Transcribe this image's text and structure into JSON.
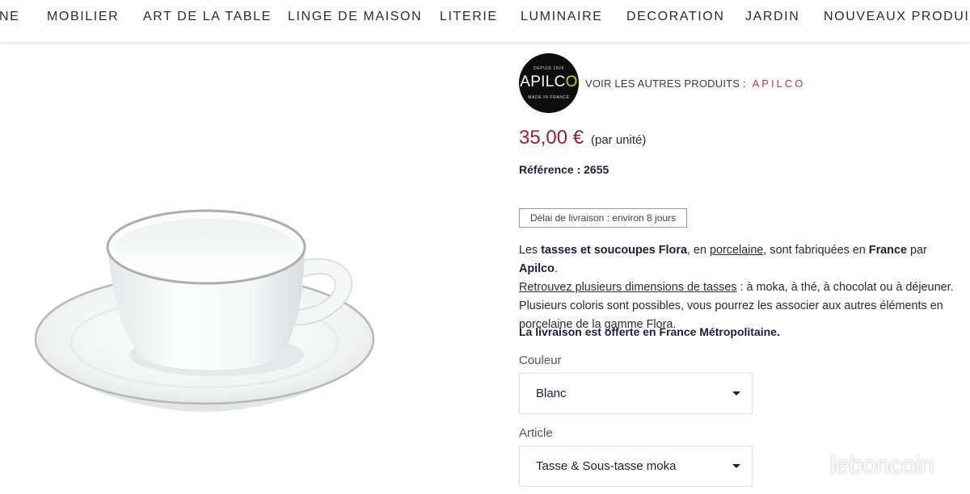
{
  "nav": {
    "items": [
      "NE",
      "MOBILIER",
      "ART DE LA TABLE",
      "LINGE DE MAISON",
      "LITERIE",
      "LUMINAIRE",
      "DECORATION",
      "JARDIN",
      "NOUVEAUX PRODUITS"
    ]
  },
  "product_image": {
    "alt": "cup-and-saucer",
    "trim_color": "#b5b5b5"
  },
  "brand": {
    "logo_top": "DEPUIS 1826",
    "logo_name_start": "APILC",
    "logo_name_o": "O",
    "logo_bottom": "MADE IN FRANCE",
    "other_products_label": "VOIR LES AUTRES PRODUITS :",
    "brand_link": "APILCO"
  },
  "price": {
    "amount": "35,00 €",
    "unit": "(par unité)"
  },
  "reference": "Référence : 2655",
  "delivery_badge": "Délai de livraison : environ 8 jours",
  "description": {
    "t1": "Les ",
    "b1": "tasses et soucoupes Flora",
    "t2": ", en ",
    "link1": "porcelaine",
    "t3": ", sont fabriquées en ",
    "b2": "France",
    "t4": " par ",
    "b3": "Apilco",
    "t5": ".",
    "link2": "Retrouvez plusieurs dimensions de tasses",
    "t6": " : à moka, à thé, à chocolat ou à déjeuner. Plusieurs coloris sont possibles, vous pourrez les associer aux autres éléments en porcelaine de la gamme Flora."
  },
  "free_delivery": "La livraison est offerte en France Métropolitaine.",
  "options": {
    "color_label": "Couleur",
    "color_value": "Blanc",
    "article_label": "Article",
    "article_value": "Tasse & Sous-tasse moka"
  },
  "watermark": "leboncoin",
  "colors": {
    "price": "#a01e2e",
    "brand_link": "#c0392b",
    "text": "#2a2a3a"
  }
}
